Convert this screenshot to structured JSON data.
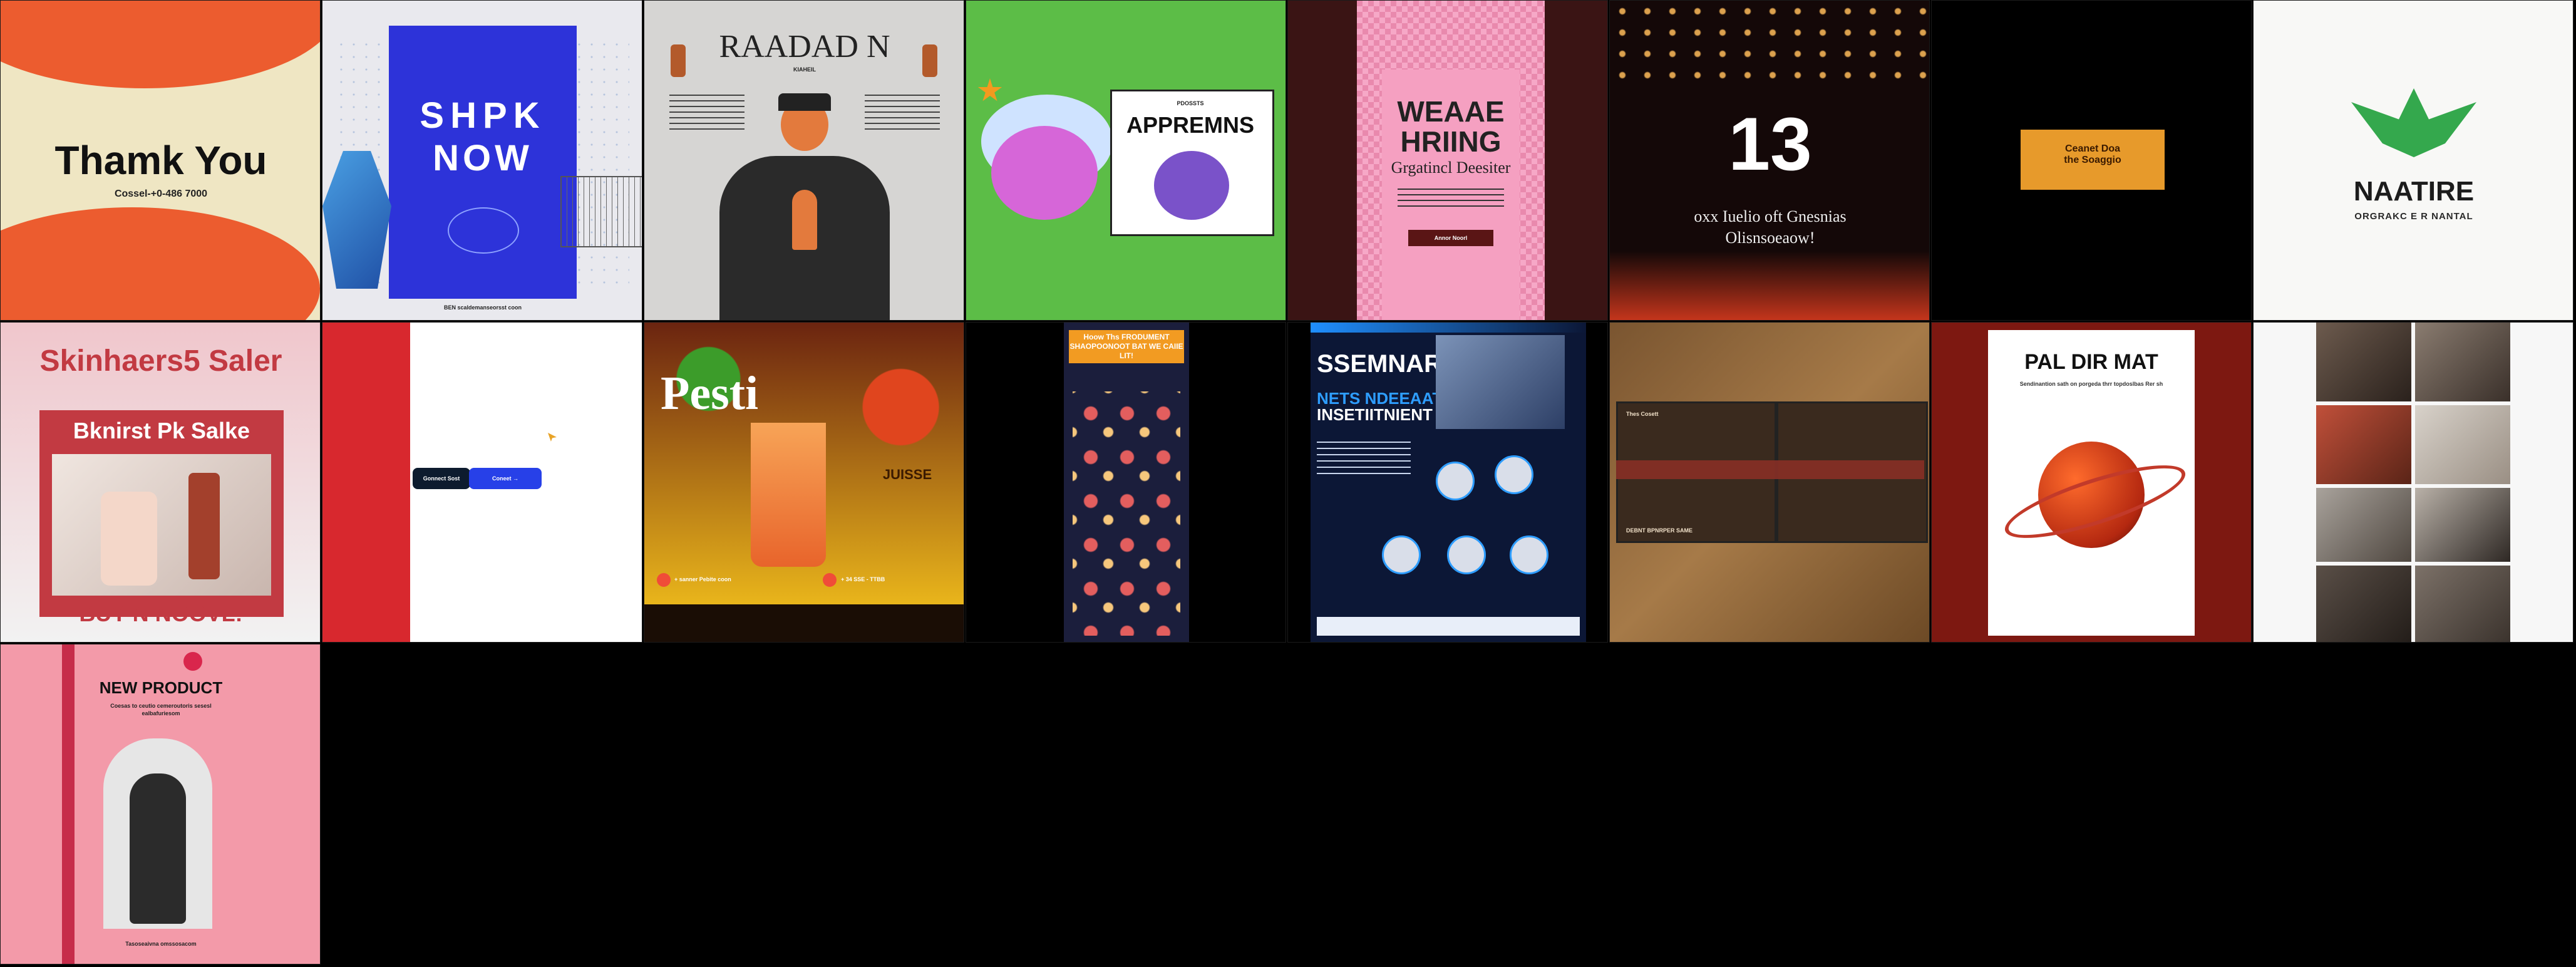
{
  "tiles": {
    "t1": {
      "title": "Thamk You",
      "phone": "Cossel-+0-486 7000"
    },
    "t2": {
      "title_line1": "SHPK",
      "title_line2": "NOW",
      "footer": "BEN scaldemanseorsst coon"
    },
    "t3": {
      "title": "RAADAD N",
      "subtitle": "KIAHEIL"
    },
    "t4": {
      "title_top": "PDOSSTS",
      "title": "APPREMNS"
    },
    "t5": {
      "title_line1": "WEAAE",
      "title_line2": "HRIING",
      "subtitle": "Grgatincl Deesiter",
      "button": "Annor Noorl"
    },
    "t6": {
      "title": "13",
      "line1": "oxx Iuelio oft Gnesnias",
      "line2": "Olisnsoeaow!"
    },
    "t7": {
      "button": "Ceanet Doa\nthe Soaggio"
    },
    "t8": {
      "title": "NAATIRE",
      "subtitle": "ORGRAKC E R NANTAL"
    },
    "t9": {
      "title": "Skinhaers5 Saler",
      "subtitle": "Bknirst Pk Salke",
      "footer": "BUY N NOOVL!"
    },
    "t10": {
      "pill1": "Gonnect Sost",
      "pill2": "Coneet →"
    },
    "t11": {
      "title": "Pesti",
      "badge": "JUISSE",
      "phone1": "+ sanner Pebite coon",
      "phone2": "+ 34 SSE - TTBB"
    },
    "t12": {
      "title": "Hoow Ths FRODUMENT SHAOPOONOOT BAT WE CAIIE LIT!"
    },
    "t13": {
      "title_line1": "SSEMNAR",
      "title_line2": "NETS NDEEAAT",
      "title_line3": "INSETIITNIENT"
    },
    "t14": {
      "label": "Thes Cosett",
      "footer": "DEBNT BPNRPER SAME"
    },
    "t15": {
      "title": "PAL DIR MAT",
      "subtitle": "Sendinantion sath on porgeda thrr topdoslbas Rer sh"
    },
    "t16": {},
    "t17": {
      "title": "NEW PRODUCT",
      "subtitle": "Coesas to ceutio cemeroutoris sesesl ealbafuriesom",
      "footer": "Tasoseaivna omssosacom"
    }
  },
  "colors": {
    "page_bg": "#000000",
    "grid_line": "#1b1b1b"
  }
}
